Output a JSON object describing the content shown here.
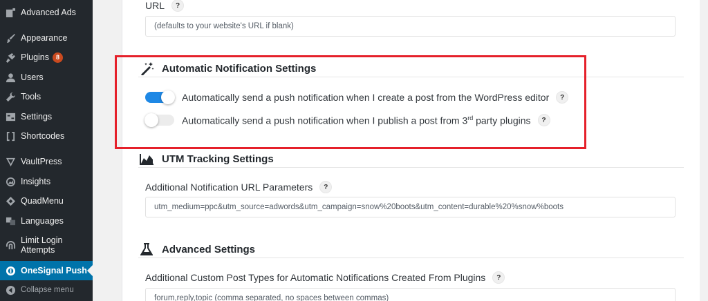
{
  "sidebar": {
    "items": [
      {
        "label": "Advanced Ads",
        "icon": "advanced-ads-icon"
      },
      {
        "label": "Appearance",
        "icon": "paintbrush-icon"
      },
      {
        "label": "Plugins",
        "icon": "plugin-icon",
        "badge": "8"
      },
      {
        "label": "Users",
        "icon": "user-icon"
      },
      {
        "label": "Tools",
        "icon": "wrench-icon"
      },
      {
        "label": "Settings",
        "icon": "settings-icon"
      },
      {
        "label": "Shortcodes",
        "icon": "brackets-icon"
      },
      {
        "label": "VaultPress",
        "icon": "vaultpress-icon"
      },
      {
        "label": "Insights",
        "icon": "insights-icon"
      },
      {
        "label": "QuadMenu",
        "icon": "quadmenu-icon"
      },
      {
        "label": "Languages",
        "icon": "translate-icon"
      },
      {
        "label": "Limit Login",
        "label2": "Attempts",
        "icon": "fingerprint-icon"
      },
      {
        "label": "OneSignal Push",
        "icon": "onesignal-icon",
        "active": true
      },
      {
        "label": "Collapse menu",
        "icon": "collapse-icon"
      }
    ]
  },
  "url_field": {
    "label": "URL",
    "help": "?",
    "placeholder": "(defaults to your website's URL if blank)"
  },
  "auto_notification": {
    "title": "Automatic Notification Settings",
    "options": [
      {
        "text": "Automatically send a push notification when I create a post from the WordPress editor",
        "enabled": true,
        "help": "?"
      },
      {
        "text_before": "Automatically send a push notification when I publish a post from 3",
        "sup": "rd",
        "text_after": " party plugins",
        "enabled": false,
        "help": "?"
      }
    ]
  },
  "utm": {
    "title": "UTM Tracking Settings",
    "field_label": "Additional Notification URL Parameters",
    "help": "?",
    "value": "utm_medium=ppc&utm_source=adwords&utm_campaign=snow%20boots&utm_content=durable%20%snow%boots"
  },
  "advanced": {
    "title": "Advanced Settings",
    "field_label": "Additional Custom Post Types for Automatic Notifications Created From Plugins",
    "help": "?",
    "placeholder": "forum,reply,topic  (comma separated, no spaces between commas)"
  },
  "colors": {
    "sidebar_bg": "#23282d",
    "active_bg": "#0073aa",
    "toggle_on": "#1e88e5",
    "highlight": "#e5202a",
    "badge": "#ca4a1f"
  }
}
